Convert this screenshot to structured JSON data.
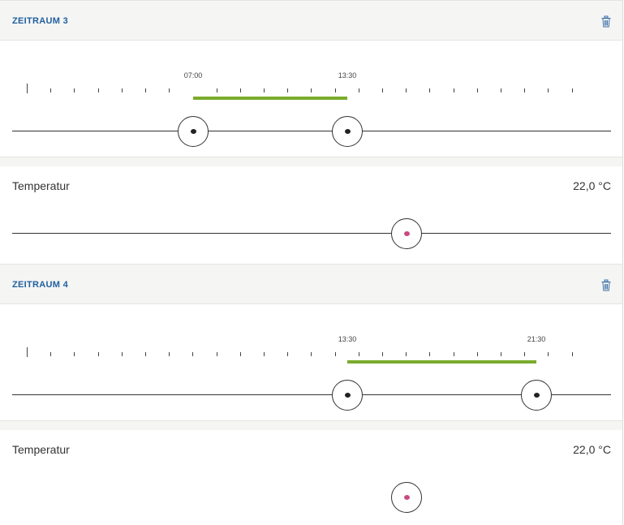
{
  "periods": [
    {
      "title": "ZEITRAUM 3",
      "start_label": "07:00",
      "end_label": "13:30",
      "start_time": "07:00",
      "end_time": "13:30",
      "temperature": {
        "label": "Temperatur",
        "value_text": "22,0 °C",
        "value": 22.0
      },
      "temperature_track_visible": true
    },
    {
      "title": "ZEITRAUM 4",
      "start_label": "13:30",
      "end_label": "21:30",
      "start_time": "13:30",
      "end_time": "21:30",
      "temperature": {
        "label": "Temperatur",
        "value_text": "22,0 °C",
        "value": 22.0
      },
      "temperature_track_visible": false
    }
  ],
  "icons": {
    "delete": "trash-icon"
  },
  "colors": {
    "accent_title": "#1f5f9e",
    "range_bar": "#7aab2c",
    "temp_dot": "#c94b7d"
  }
}
